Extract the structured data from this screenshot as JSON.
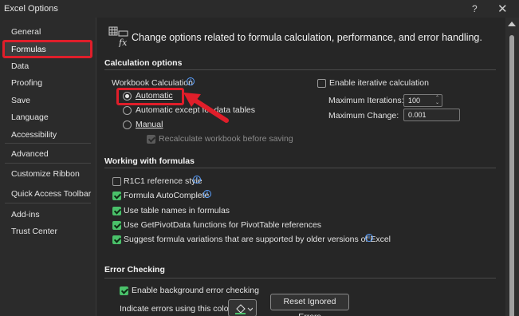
{
  "window": {
    "title": "Excel Options",
    "help_glyph": "?",
    "close_glyph": "✕"
  },
  "sidebar": {
    "items": [
      {
        "label": "General"
      },
      {
        "label": "Formulas"
      },
      {
        "label": "Data"
      },
      {
        "label": "Proofing"
      },
      {
        "label": "Save"
      },
      {
        "label": "Language"
      },
      {
        "label": "Accessibility"
      },
      {
        "label": "Advanced"
      },
      {
        "label": "Customize Ribbon"
      },
      {
        "label": "Quick Access Toolbar"
      },
      {
        "label": "Add-ins"
      },
      {
        "label": "Trust Center"
      }
    ],
    "active": "Formulas"
  },
  "header": {
    "text": "Change options related to formula calculation, performance, and error handling."
  },
  "calculation": {
    "title": "Calculation options",
    "workbook_label": "Workbook Calculation",
    "radio_automatic": "Automatic",
    "radio_auto_except_pre": "Automatic excep",
    "radio_auto_except_mid": "t fo",
    "radio_auto_except_post": "r data tables",
    "radio_manual": "Manual",
    "recalc_before_save": "Recalculate workbook before saving",
    "iterative_label": "Enable iterative calculation",
    "max_iterations_label": "Maximum Iterations:",
    "max_iterations_value": "100",
    "max_change_label": "Maximum Change:",
    "max_change_value": "0.001"
  },
  "working": {
    "title": "Working with formulas",
    "r1c1": "R1C1 reference style",
    "autocomplete": "Formula AutoComplete",
    "table_names": "Use table names in formulas",
    "getpivotdata": "Use GetPivotData functions for PivotTable references",
    "suggest_variations": "Suggest formula variations that are supported by older versions of Excel"
  },
  "error_checking": {
    "title": "Error Checking",
    "enable_background": "Enable background error checking",
    "indicate_color": "Indicate errors using this color:",
    "reset_button": "Reset Ignored Errors"
  },
  "colors": {
    "accent_check": "#4ac16a",
    "highlight": "#e01e2a",
    "info": "#5aa0ff"
  }
}
